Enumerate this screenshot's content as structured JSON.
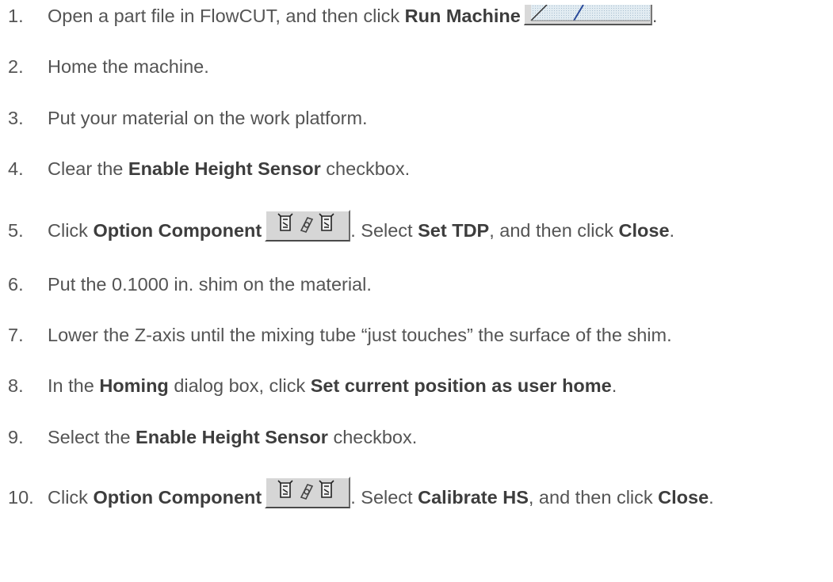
{
  "steps": [
    {
      "num": "1.",
      "parts": [
        "Open a part file in FlowCUT, and then click ",
        "Run Machine",
        "."
      ],
      "icon": "run-machine-icon"
    },
    {
      "num": "2.",
      "text": "Home the machine."
    },
    {
      "num": "3.",
      "text": "Put your material on the work platform."
    },
    {
      "num": "4.",
      "parts": [
        "Clear the ",
        "Enable Height Sensor",
        " checkbox."
      ]
    },
    {
      "num": "5.",
      "parts": [
        "Click ",
        "Option Component",
        ". Select ",
        "Set TDP",
        ", and then click ",
        "Close",
        "."
      ],
      "icon": "option-component-icon"
    },
    {
      "num": "6.",
      "text": "Put the 0.1000 in. shim on the material."
    },
    {
      "num": "7.",
      "text": "Lower the Z-axis until the mixing tube “just touches” the surface of the shim."
    },
    {
      "num": "8.",
      "parts": [
        "In the ",
        "Homing",
        " dialog box, click ",
        "Set current position as user home",
        "."
      ]
    },
    {
      "num": "9.",
      "parts": [
        "Select the ",
        "Enable Height Sensor",
        " checkbox."
      ]
    },
    {
      "num": "10.",
      "parts": [
        "Click ",
        "Option Component",
        ". Select ",
        "Calibrate HS",
        ", and then click ",
        "Close",
        "."
      ],
      "icon": "option-component-icon"
    }
  ]
}
